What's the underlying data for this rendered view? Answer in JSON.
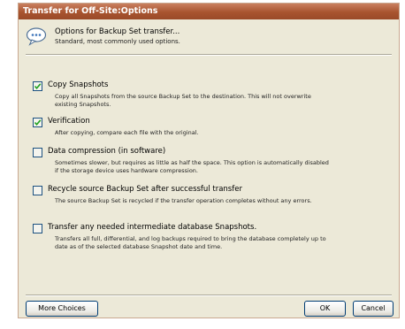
{
  "window": {
    "title": "Transfer for Off-Site:Options"
  },
  "header": {
    "icon": "speech-bubble-icon",
    "title": "Options for Backup Set transfer...",
    "subtitle": "Standard, most commonly used options."
  },
  "options": [
    {
      "label": "Copy Snapshots",
      "description": "Copy all Snapshots from the source Backup Set to the destination. This will not overwrite existing Snapshots.",
      "checked": true
    },
    {
      "label": "Verification",
      "description": "After copying, compare each file with the original.",
      "checked": true
    },
    {
      "label": "Data compression (in software)",
      "description": "Sometimes slower, but requires as little as half the space. This option is automatically disabled if the storage device uses hardware compression.",
      "checked": false
    },
    {
      "label": "Recycle source Backup Set after successful transfer",
      "description": "The source Backup Set is recycled if the transfer operation completes without any errors.",
      "checked": false
    },
    {
      "label": "Transfer any needed intermediate database Snapshots.",
      "description": "Transfers all full, differential, and log backups required to bring the database completely up to date as of the selected database Snapshot date and time.",
      "checked": false
    }
  ],
  "buttons": {
    "more_choices": "More Choices",
    "ok": "OK",
    "cancel": "Cancel"
  },
  "colors": {
    "titlebar": "#a8542f",
    "dialog_background": "#ece9d8",
    "checkmark": "#21a121"
  }
}
